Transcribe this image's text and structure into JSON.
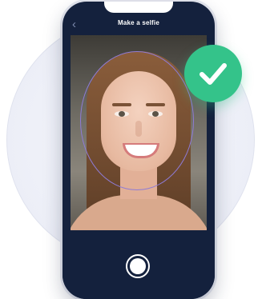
{
  "app": {
    "header": {
      "title": "Make a selfie"
    },
    "icons": {
      "back": "chevron-left-icon",
      "success": "checkmark-icon",
      "shutter": "camera-shutter-icon"
    },
    "colors": {
      "phone_bg": "#14213d",
      "success": "#34c38a",
      "guide_oval": "#8e7bd6"
    }
  }
}
